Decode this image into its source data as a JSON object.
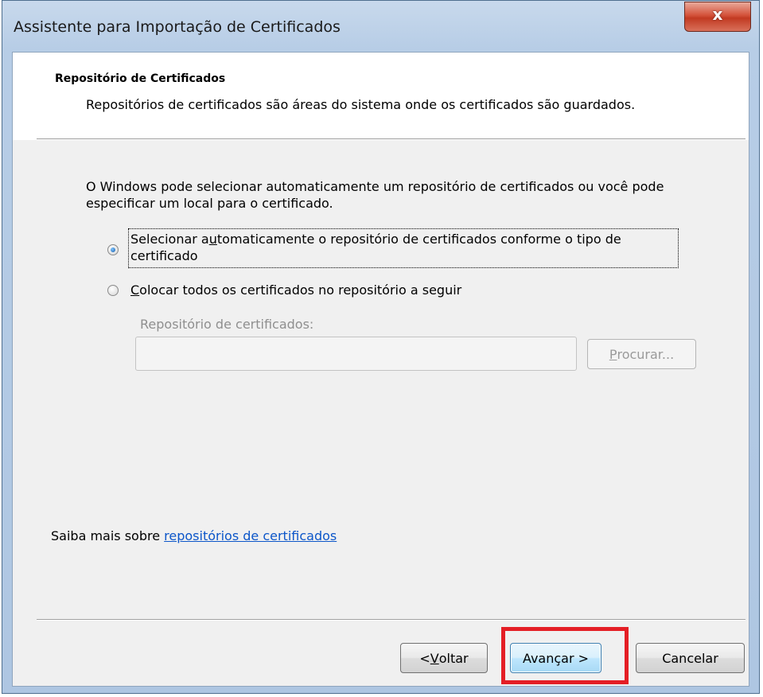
{
  "window": {
    "title": "Assistente para Importação de Certificados",
    "close_glyph": "x"
  },
  "header": {
    "section_title": "Repositório de Certificados",
    "section_description": "Repositórios de certificados são áreas do sistema onde os certificados são guardados."
  },
  "body": {
    "intro": "O Windows pode selecionar automaticamente um repositório de certificados ou você pode especificar um local para o certificado.",
    "options": [
      {
        "label_pre": "Selecionar a",
        "label_mn": "u",
        "label_post": "tomaticamente o repositório de certificados conforme o tipo de certificado",
        "selected": true
      },
      {
        "label_pre": "",
        "label_mn": "C",
        "label_post": "olocar todos os certificados no repositório a seguir",
        "selected": false
      }
    ],
    "store_label": "Repositório de certificados:",
    "store_value": "",
    "browse_button": {
      "pre": "",
      "mn": "P",
      "post": "rocurar..."
    },
    "learn_more_prefix": "Saiba mais sobre",
    "learn_more_link": "repositórios de certificados"
  },
  "footer": {
    "back_button": {
      "pre": "< ",
      "mn": "V",
      "post": "oltar"
    },
    "next_button": "Avançar >",
    "cancel_button": "Cancelar"
  },
  "colors": {
    "highlight_border": "#e41e25",
    "link": "#0c56c9"
  }
}
